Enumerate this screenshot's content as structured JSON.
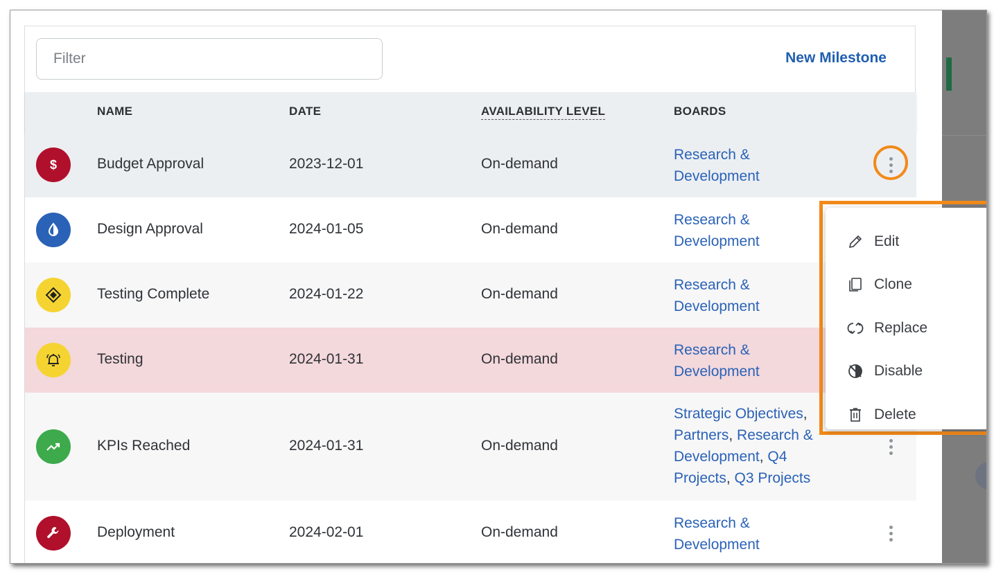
{
  "filter": {
    "placeholder": "Filter"
  },
  "new_milestone_label": "New Milestone",
  "columns": {
    "name": "NAME",
    "date": "DATE",
    "availability": "AVAILABILITY LEVEL",
    "boards": "BOARDS"
  },
  "rows": [
    {
      "name": "Budget Approval",
      "date": "2023-12-01",
      "availability": "On-demand",
      "board_lines": [
        "Research &",
        "Development"
      ],
      "icon": "dollar-icon",
      "icon_color": "#b0102b",
      "bg": "#eceff2"
    },
    {
      "name": "Design Approval",
      "date": "2024-01-05",
      "availability": "On-demand",
      "board_lines": [
        "Research &",
        "Development"
      ],
      "icon": "contrast-icon",
      "icon_color": "#2a62b7",
      "bg": "#ffffff"
    },
    {
      "name": "Testing Complete",
      "date": "2024-01-22",
      "availability": "On-demand",
      "board_lines": [
        "Research &",
        "Development"
      ],
      "icon": "diamond-icon",
      "icon_color": "#f5d432",
      "bg": "#f7f7f7"
    },
    {
      "name": "Testing",
      "date": "2024-01-31",
      "availability": "On-demand",
      "board_lines": [
        "Research &",
        "Development"
      ],
      "icon": "bell-icon",
      "icon_color": "#f5d432",
      "bg": "#f3d8dc"
    },
    {
      "name": "KPIs Reached",
      "date": "2024-01-31",
      "availability": "On-demand",
      "board_lines": [
        "Strategic Objectives",
        "Partners",
        "Research &",
        "Development",
        "Q4",
        "Projects",
        "Q3 Projects"
      ],
      "icon": "trending-up-icon",
      "icon_color": "#3daa4c",
      "bg": "#f7f7f7"
    },
    {
      "name": "Deployment",
      "date": "2024-02-01",
      "availability": "On-demand",
      "board_lines": [
        "Research &",
        "Development"
      ],
      "icon": "wrench-icon",
      "icon_color": "#b0102b",
      "bg": "#ffffff"
    }
  ],
  "menu": {
    "items": [
      {
        "label": "Edit",
        "icon": "pencil-icon"
      },
      {
        "label": "Clone",
        "icon": "copy-icon"
      },
      {
        "label": "Replace",
        "icon": "swap-icon"
      },
      {
        "label": "Disable",
        "icon": "disable-icon"
      },
      {
        "label": "Delete",
        "icon": "trash-icon"
      }
    ]
  },
  "colors": {
    "accent": "#1f5fb0",
    "highlight": "#f28a1a",
    "danger_row": "#f3d8dc"
  }
}
